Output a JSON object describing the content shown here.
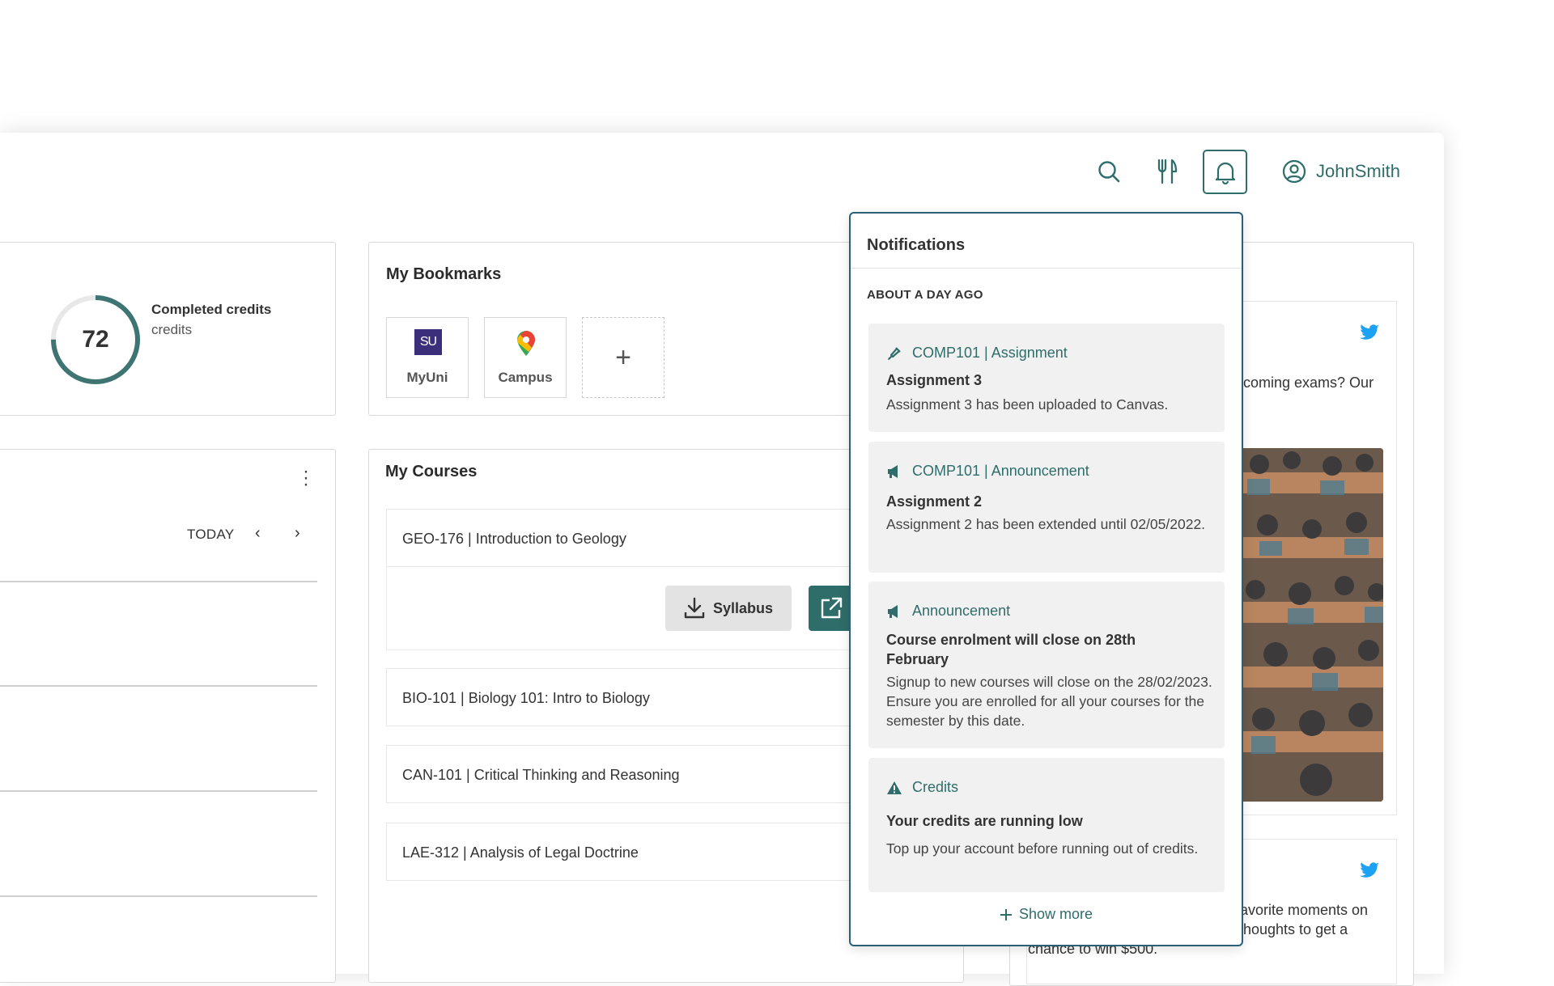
{
  "header": {
    "icons": [
      "search-icon",
      "restaurant-icon",
      "bell-icon"
    ],
    "username": "JohnSmith",
    "accent_color": "#2f6d6a"
  },
  "credits": {
    "value": "72",
    "label": "Completed credits",
    "sublabel": "credits",
    "ring_fraction": 0.75
  },
  "bookmarks": {
    "title": "My Bookmarks",
    "items": [
      {
        "label": "MyUni",
        "icon": "SU"
      },
      {
        "label": "Campus",
        "icon": "map-pin-icon"
      }
    ],
    "add": "+"
  },
  "calendar": {
    "today_label": "TODAY",
    "prev": "‹",
    "next": "›"
  },
  "courses": {
    "title": "My Courses",
    "items": [
      "GEO-176 | Introduction to Geology",
      "BIO-101 | Biology 101: Intro to Biology",
      "CAN-101 | Critical Thinking and Reasoning",
      "LAE-312 | Analysis of Legal Doctrine"
    ],
    "syllabus_label": "Syllabus"
  },
  "feed": {
    "post1_text": "coming exams? Our",
    "post2_text_lines": [
      "avorite moments on",
      "houghts to get a",
      "chance to win $500."
    ],
    "brand_color": "#1da1f2"
  },
  "notifications": {
    "title": "Notifications",
    "section": "ABOUT A DAY AGO",
    "items": [
      {
        "category": "COMP101 | Assignment",
        "icon": "pen-icon",
        "title": "Assignment 3",
        "body": "Assignment 3 has been uploaded to Canvas."
      },
      {
        "category": "COMP101 | Announcement",
        "icon": "megaphone-icon",
        "title": "Assignment 2",
        "body": "Assignment 2 has been extended until 02/05/2022."
      },
      {
        "category": "Announcement",
        "icon": "megaphone-icon",
        "title": "Course enrolment will close on 28th February",
        "body": "Signup to new courses will close on the 28/02/2023. Ensure you are enrolled for all your courses for the semester by this date."
      },
      {
        "category": "Credits",
        "icon": "warning-icon",
        "title": "Your credits are running low",
        "body": "Top up your account before running out of credits."
      }
    ],
    "show_more": "Show more"
  }
}
